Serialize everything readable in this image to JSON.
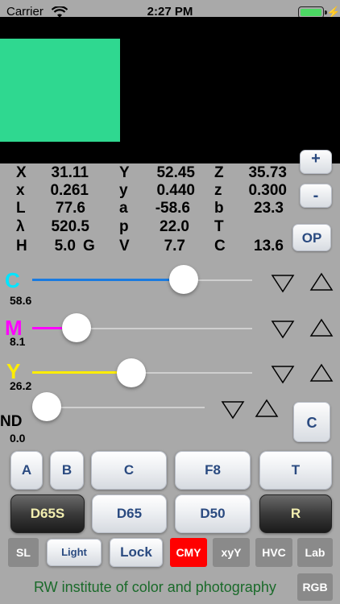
{
  "status": {
    "carrier": "Carrier",
    "time": "2:27 PM"
  },
  "colors": {
    "swatch": "#2fd890",
    "cyan": "#00e5ff",
    "magenta": "#ff00ff",
    "yellow": "#ffee00",
    "blue_track": "#1a7be0",
    "red_tab": "#ff0000"
  },
  "values": {
    "row1": {
      "l1": "X",
      "v1": "31.11",
      "l2": "Y",
      "v2": "52.45",
      "l3": "Z",
      "v3": "35.73"
    },
    "row2": {
      "l1": "x",
      "v1": "0.261",
      "l2": "y",
      "v2": "0.440",
      "l3": "z",
      "v3": "0.300"
    },
    "row3": {
      "l1": "L",
      "v1": "77.6",
      "l2": "a",
      "v2": "-58.6",
      "l3": "b",
      "v3": "23.3"
    },
    "row4": {
      "l1": "λ",
      "v1": "520.5",
      "l2": "p",
      "v2": "22.0",
      "l3": "T",
      "v3": ""
    },
    "row5": {
      "l1": "H",
      "v1": "5.0",
      "g": "G",
      "l2": "V",
      "v2": "7.7",
      "l3": "C",
      "v3": "13.6"
    }
  },
  "side_buttons": {
    "plus": "+",
    "minus": "-",
    "op": "OP"
  },
  "sliders": [
    {
      "letter": "C",
      "value": "58.6",
      "fraction": 0.69
    },
    {
      "letter": "M",
      "value": "8.1",
      "fraction": 0.2
    },
    {
      "letter": "Y",
      "value": "26.2",
      "fraction": 0.45
    },
    {
      "letter": "ND",
      "value": "0.0",
      "fraction": 0.0
    }
  ],
  "c_button": "C",
  "row_a": {
    "a": "A",
    "b": "B",
    "c": "C",
    "f8": "F8",
    "t": "T"
  },
  "row_b": {
    "d65s": "D65S",
    "d65": "D65",
    "d50": "D50",
    "r": "R"
  },
  "row_c": {
    "sl": "SL",
    "light": "Light",
    "lock": "Lock",
    "cmy": "CMY",
    "xyy": "xyY",
    "hvc": "HVC",
    "lab": "Lab"
  },
  "footer": {
    "text": "RW institute of color and photography",
    "rgb": "RGB"
  }
}
